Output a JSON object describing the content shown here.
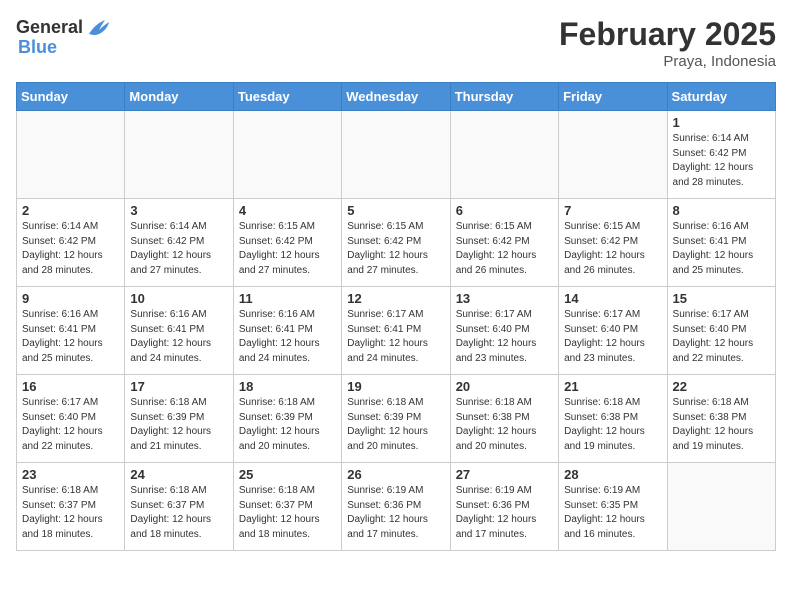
{
  "logo": {
    "text_general": "General",
    "text_blue": "Blue"
  },
  "title": "February 2025",
  "location": "Praya, Indonesia",
  "days_of_week": [
    "Sunday",
    "Monday",
    "Tuesday",
    "Wednesday",
    "Thursday",
    "Friday",
    "Saturday"
  ],
  "weeks": [
    [
      {
        "day": "",
        "info": ""
      },
      {
        "day": "",
        "info": ""
      },
      {
        "day": "",
        "info": ""
      },
      {
        "day": "",
        "info": ""
      },
      {
        "day": "",
        "info": ""
      },
      {
        "day": "",
        "info": ""
      },
      {
        "day": "1",
        "info": "Sunrise: 6:14 AM\nSunset: 6:42 PM\nDaylight: 12 hours\nand 28 minutes."
      }
    ],
    [
      {
        "day": "2",
        "info": "Sunrise: 6:14 AM\nSunset: 6:42 PM\nDaylight: 12 hours\nand 28 minutes."
      },
      {
        "day": "3",
        "info": "Sunrise: 6:14 AM\nSunset: 6:42 PM\nDaylight: 12 hours\nand 27 minutes."
      },
      {
        "day": "4",
        "info": "Sunrise: 6:15 AM\nSunset: 6:42 PM\nDaylight: 12 hours\nand 27 minutes."
      },
      {
        "day": "5",
        "info": "Sunrise: 6:15 AM\nSunset: 6:42 PM\nDaylight: 12 hours\nand 27 minutes."
      },
      {
        "day": "6",
        "info": "Sunrise: 6:15 AM\nSunset: 6:42 PM\nDaylight: 12 hours\nand 26 minutes."
      },
      {
        "day": "7",
        "info": "Sunrise: 6:15 AM\nSunset: 6:42 PM\nDaylight: 12 hours\nand 26 minutes."
      },
      {
        "day": "8",
        "info": "Sunrise: 6:16 AM\nSunset: 6:41 PM\nDaylight: 12 hours\nand 25 minutes."
      }
    ],
    [
      {
        "day": "9",
        "info": "Sunrise: 6:16 AM\nSunset: 6:41 PM\nDaylight: 12 hours\nand 25 minutes."
      },
      {
        "day": "10",
        "info": "Sunrise: 6:16 AM\nSunset: 6:41 PM\nDaylight: 12 hours\nand 24 minutes."
      },
      {
        "day": "11",
        "info": "Sunrise: 6:16 AM\nSunset: 6:41 PM\nDaylight: 12 hours\nand 24 minutes."
      },
      {
        "day": "12",
        "info": "Sunrise: 6:17 AM\nSunset: 6:41 PM\nDaylight: 12 hours\nand 24 minutes."
      },
      {
        "day": "13",
        "info": "Sunrise: 6:17 AM\nSunset: 6:40 PM\nDaylight: 12 hours\nand 23 minutes."
      },
      {
        "day": "14",
        "info": "Sunrise: 6:17 AM\nSunset: 6:40 PM\nDaylight: 12 hours\nand 23 minutes."
      },
      {
        "day": "15",
        "info": "Sunrise: 6:17 AM\nSunset: 6:40 PM\nDaylight: 12 hours\nand 22 minutes."
      }
    ],
    [
      {
        "day": "16",
        "info": "Sunrise: 6:17 AM\nSunset: 6:40 PM\nDaylight: 12 hours\nand 22 minutes."
      },
      {
        "day": "17",
        "info": "Sunrise: 6:18 AM\nSunset: 6:39 PM\nDaylight: 12 hours\nand 21 minutes."
      },
      {
        "day": "18",
        "info": "Sunrise: 6:18 AM\nSunset: 6:39 PM\nDaylight: 12 hours\nand 20 minutes."
      },
      {
        "day": "19",
        "info": "Sunrise: 6:18 AM\nSunset: 6:39 PM\nDaylight: 12 hours\nand 20 minutes."
      },
      {
        "day": "20",
        "info": "Sunrise: 6:18 AM\nSunset: 6:38 PM\nDaylight: 12 hours\nand 20 minutes."
      },
      {
        "day": "21",
        "info": "Sunrise: 6:18 AM\nSunset: 6:38 PM\nDaylight: 12 hours\nand 19 minutes."
      },
      {
        "day": "22",
        "info": "Sunrise: 6:18 AM\nSunset: 6:38 PM\nDaylight: 12 hours\nand 19 minutes."
      }
    ],
    [
      {
        "day": "23",
        "info": "Sunrise: 6:18 AM\nSunset: 6:37 PM\nDaylight: 12 hours\nand 18 minutes."
      },
      {
        "day": "24",
        "info": "Sunrise: 6:18 AM\nSunset: 6:37 PM\nDaylight: 12 hours\nand 18 minutes."
      },
      {
        "day": "25",
        "info": "Sunrise: 6:18 AM\nSunset: 6:37 PM\nDaylight: 12 hours\nand 18 minutes."
      },
      {
        "day": "26",
        "info": "Sunrise: 6:19 AM\nSunset: 6:36 PM\nDaylight: 12 hours\nand 17 minutes."
      },
      {
        "day": "27",
        "info": "Sunrise: 6:19 AM\nSunset: 6:36 PM\nDaylight: 12 hours\nand 17 minutes."
      },
      {
        "day": "28",
        "info": "Sunrise: 6:19 AM\nSunset: 6:35 PM\nDaylight: 12 hours\nand 16 minutes."
      },
      {
        "day": "",
        "info": ""
      }
    ]
  ]
}
